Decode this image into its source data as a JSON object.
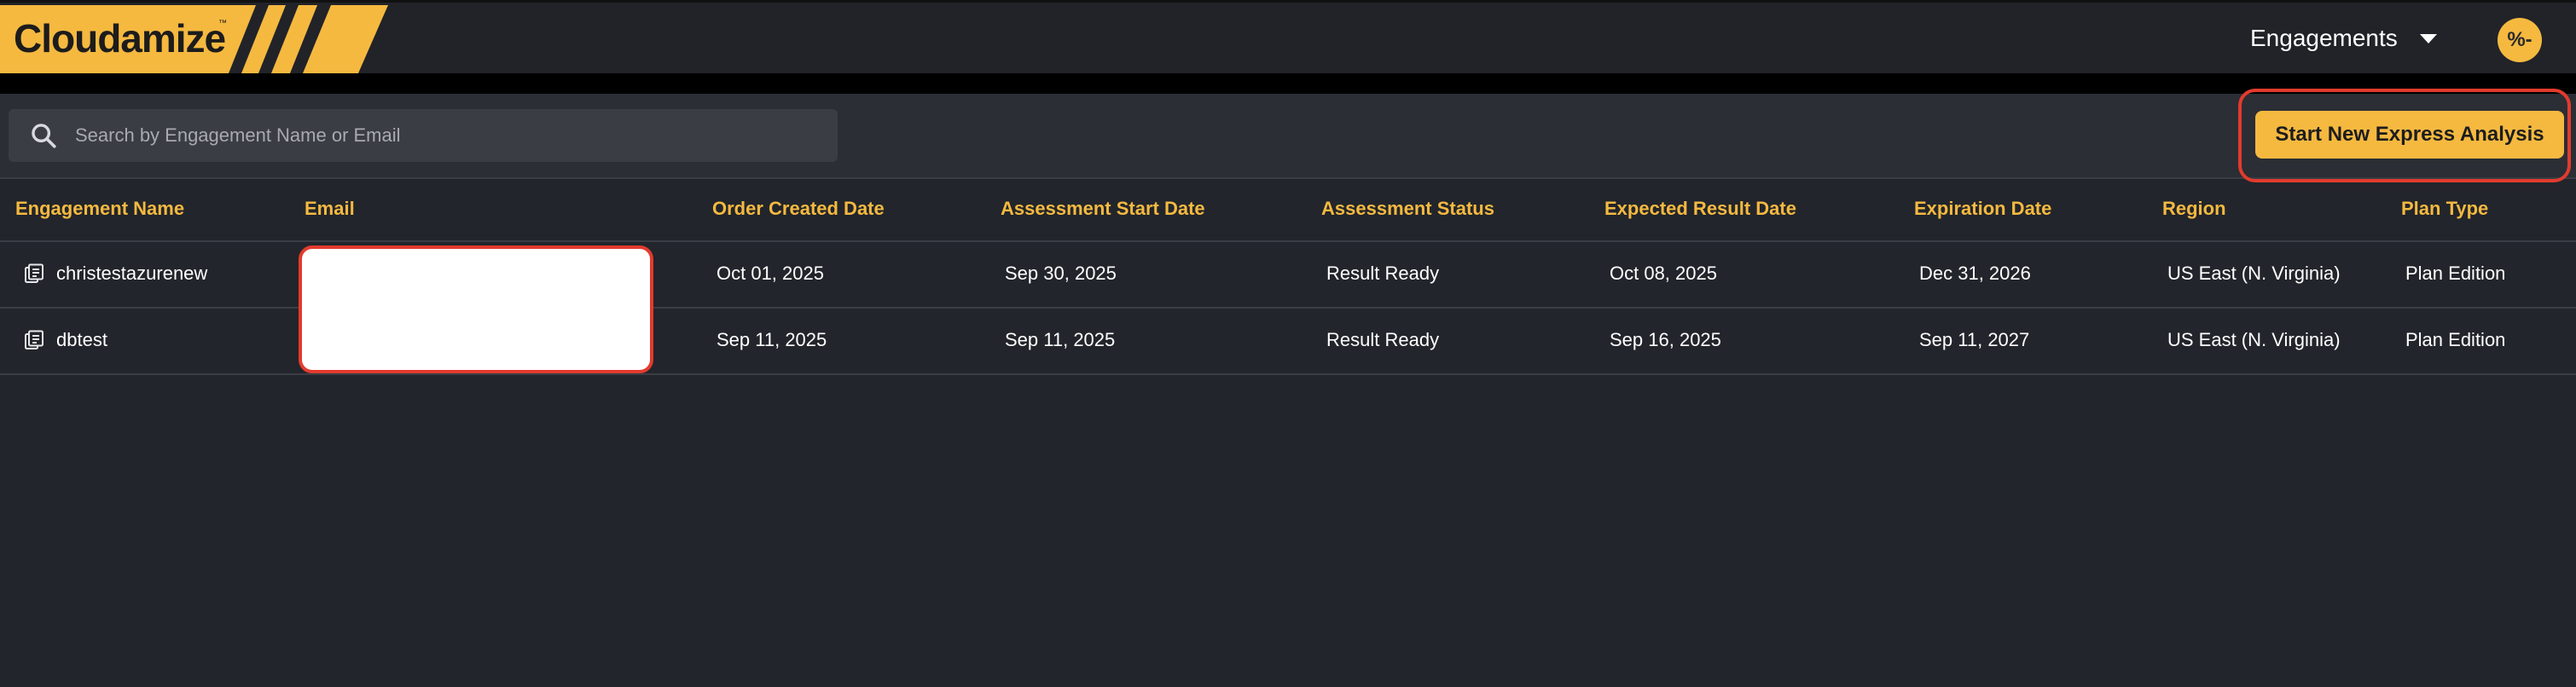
{
  "brand": {
    "name": "Cloudamize",
    "tm": "™"
  },
  "header": {
    "nav_label": "Engagements",
    "avatar_initials": "%-"
  },
  "toolbar": {
    "search_placeholder": "Search by Engagement Name or Email",
    "cta_label": "Start New Express Analysis"
  },
  "table": {
    "columns": [
      "Engagement Name",
      "Email",
      "Order Created Date",
      "Assessment Start Date",
      "Assessment Status",
      "Expected Result Date",
      "Expiration Date",
      "Region",
      "Plan Type"
    ],
    "rows": [
      {
        "name": "christestazurenew",
        "email": "",
        "order_created": "Oct 01, 2025",
        "assessment_start": "Sep 30, 2025",
        "status": "Result Ready",
        "expected_result": "Oct 08, 2025",
        "expiration": "Dec 31, 2026",
        "region": "US East (N. Virginia)",
        "plan": "Plan Edition"
      },
      {
        "name": "dbtest",
        "email": "",
        "order_created": "Sep 11, 2025",
        "assessment_start": "Sep 11, 2025",
        "status": "Result Ready",
        "expected_result": "Sep 16, 2025",
        "expiration": "Sep 11, 2027",
        "region": "US East (N. Virginia)",
        "plan": "Plan Edition"
      }
    ]
  },
  "icons": {
    "search": "search-icon",
    "row": "document-stack-icon",
    "nav_caret": "caret-down-icon"
  },
  "colors": {
    "accent": "#f5b940",
    "background": "#22252b",
    "highlight": "#e23b2e"
  }
}
